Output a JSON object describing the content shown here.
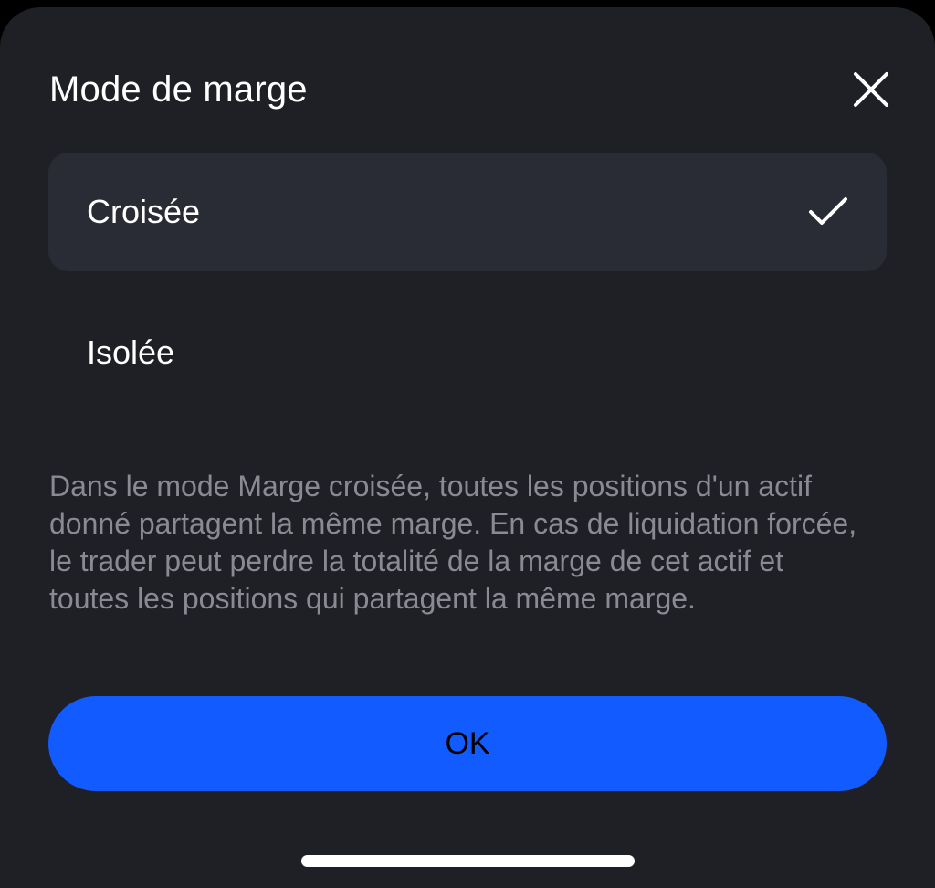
{
  "dialog": {
    "title": "Mode de marge",
    "close_icon": "close-icon"
  },
  "options": [
    {
      "label": "Croisée",
      "selected": true,
      "icon": "checkmark-icon"
    },
    {
      "label": "Isolée",
      "selected": false
    }
  ],
  "description": "Dans le mode Marge croisée, toutes les positions d'un actif donné partagent la même marge. En cas de liquidation forcée, le trader peut perdre la totalité de la marge de cet actif et toutes les positions qui partagent la même marge.",
  "confirm_button": {
    "label": "OK"
  },
  "colors": {
    "background": "#1f2025",
    "selected_option": "#2a2c35",
    "accent": "#125bff",
    "description_text": "#8a8b92"
  }
}
